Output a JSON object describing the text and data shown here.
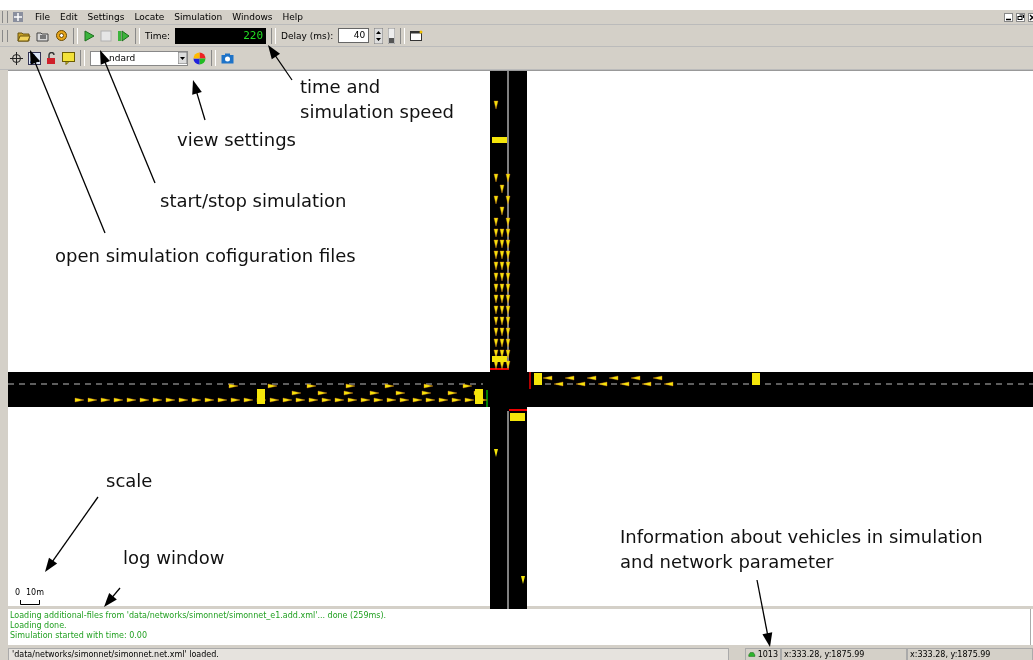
{
  "menu": [
    {
      "label": "File"
    },
    {
      "label": "Edit"
    },
    {
      "label": "Settings"
    },
    {
      "label": "Locate"
    },
    {
      "label": "Simulation"
    },
    {
      "label": "Windows"
    },
    {
      "label": "Help"
    }
  ],
  "toolbar": {
    "time_label": "Time:",
    "time_value": "220",
    "delay_label": "Delay (ms):",
    "delay_value": "40"
  },
  "view_toolbar": {
    "scheme": "ndard"
  },
  "annotations": [
    {
      "text": "time and"
    },
    {
      "text": "simulation speed"
    },
    {
      "text": "view settings"
    },
    {
      "text": "start/stop simulation"
    },
    {
      "text": "open simulation cofiguration files"
    },
    {
      "text": "scale"
    },
    {
      "text": "log window"
    },
    {
      "text": "Information about vehicles in simulation"
    },
    {
      "text": "and network parameter"
    }
  ],
  "scale": {
    "zero": "0",
    "length": "10m"
  },
  "log": [
    "Loading additional-files from 'data/networks/simonnet/simonnet_e1.add.xml'... done (259ms).",
    "Loading done.",
    "Simulation started with time: 0.00"
  ],
  "status": {
    "message": "'data/networks/simonnet/simonnet.net.xml' loaded.",
    "vehicle_count": "1013",
    "coords": [
      "x:333.28, y:1875.99",
      "x:333.28, y:1875.99"
    ]
  }
}
